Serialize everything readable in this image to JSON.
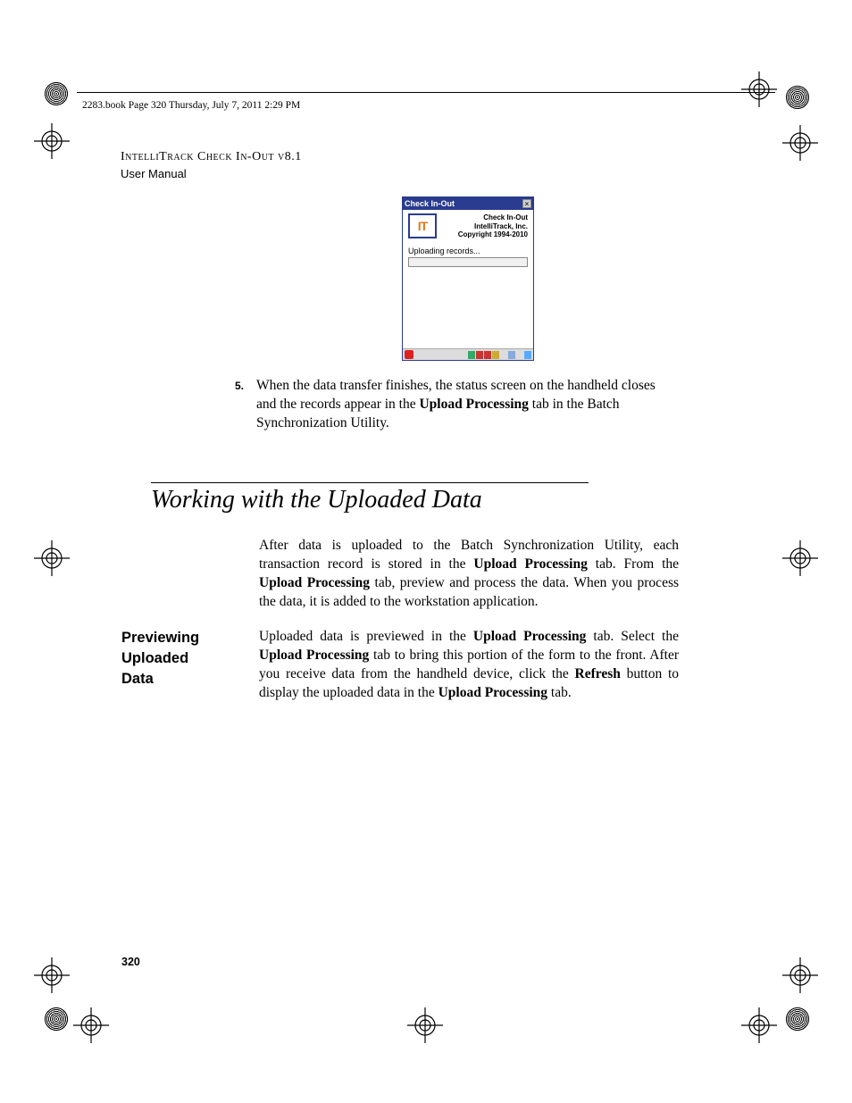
{
  "runner": "2283.book  Page 320  Thursday, July 7, 2011  2:29 PM",
  "doc_header": {
    "line1": "IntelliTrack Check In-Out v8.1",
    "line2": "User Manual"
  },
  "handheld": {
    "title": "Check In-Out",
    "meta_line1": "Check In-Out",
    "meta_line2": "IntelliTrack, Inc.",
    "meta_line3": "Copyright 1994-2010",
    "status": "Uploading records...",
    "logo_text": "IT"
  },
  "step5": {
    "num": "5.",
    "pre": "When the data transfer finishes, the status screen on the handheld closes and the records appear in the ",
    "bold1": "Upload Processing",
    "post": " tab in the Batch Synchronization Utility."
  },
  "section_title": "Working with the Uploaded Data",
  "intro": {
    "t1": "After data is uploaded to the Batch Synchronization Utility, each transaction record is stored in the ",
    "b1": "Upload Processing",
    "t2": " tab. From the ",
    "b2": "Upload Processing",
    "t3": " tab, preview and process the data. When you process the data, it is added to the workstation application."
  },
  "subhead": {
    "l1": "Previewing",
    "l2": "Uploaded",
    "l3": "Data"
  },
  "preview": {
    "t1": "Uploaded data is previewed in the ",
    "b1": "Upload Processing",
    "t2": " tab. Select the ",
    "b2": "Upload Processing",
    "t3": " tab to bring this portion of the form to the front.  After you receive data from the handheld device, click the ",
    "b3": "Refresh",
    "t4": " button to display the uploaded data in the ",
    "b4": "Upload Processing",
    "t5": " tab."
  },
  "page_num": "320"
}
